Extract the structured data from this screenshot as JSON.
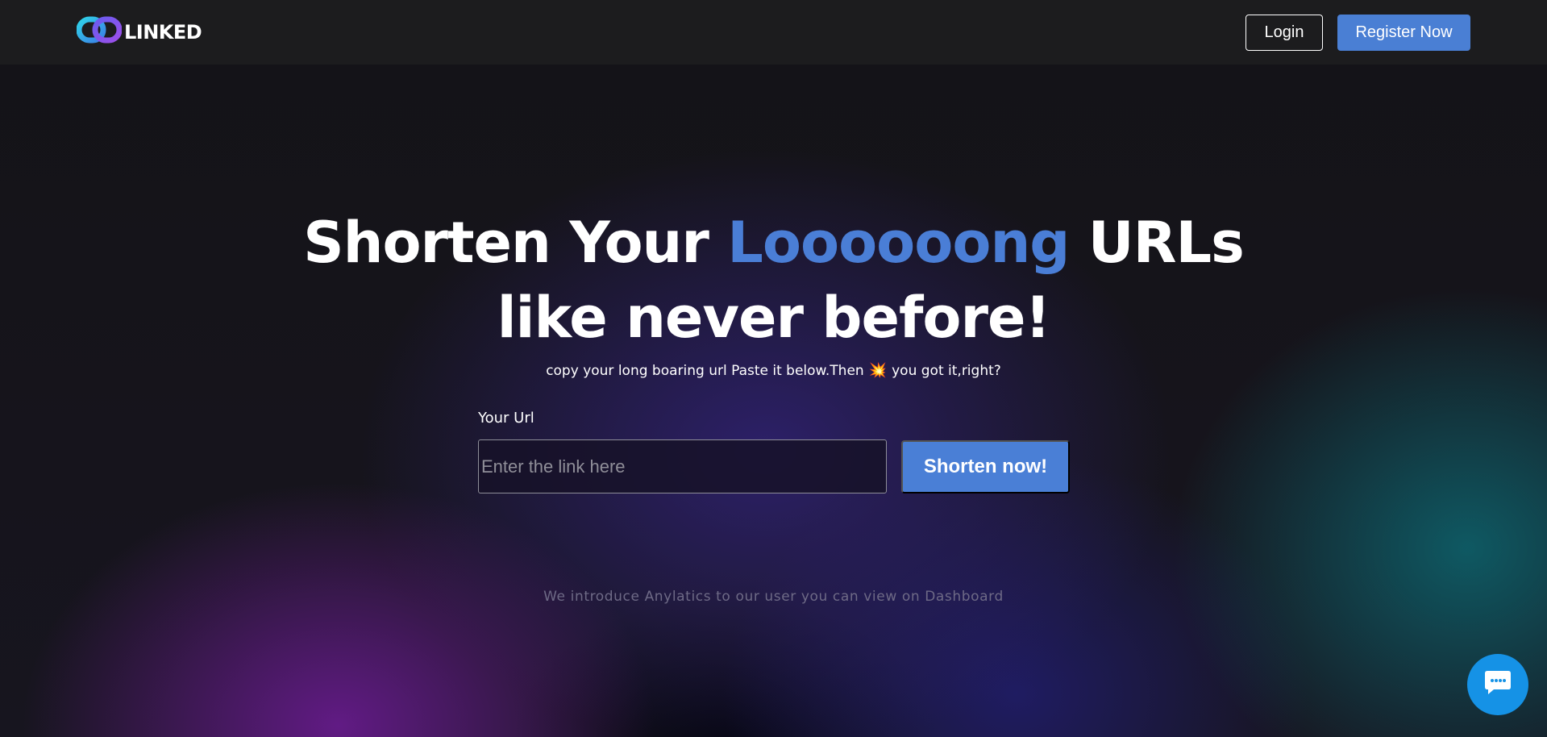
{
  "header": {
    "brand": "LINKED",
    "logo_icon": "chain-link-icon",
    "login_label": "Login",
    "register_label": "Register Now"
  },
  "hero": {
    "title_part1": "Shorten Your ",
    "title_accent": "Loooooong",
    "title_part2": " URLs",
    "title_line2": "like never before!",
    "subtitle_before": "copy your long boaring url Paste it below.Then",
    "subtitle_emoji": "💥",
    "subtitle_after": "you got it,right?"
  },
  "form": {
    "label": "Your Url",
    "input_value": "",
    "input_placeholder": "Enter the link here",
    "submit_label": "Shorten now!"
  },
  "note": "We introduce Anylatics to our user you can view on Dashboard",
  "chat": {
    "icon": "chat-bubble-icon"
  },
  "colors": {
    "accent": "#4a7ed6",
    "header_bg": "#1c1c1e",
    "chat": "#1592e6"
  }
}
